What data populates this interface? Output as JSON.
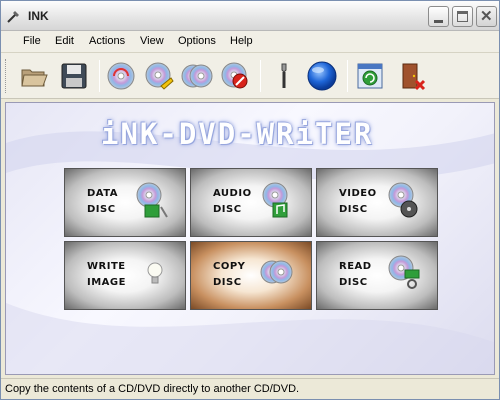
{
  "window": {
    "title": "INK"
  },
  "menu": {
    "items": [
      "File",
      "Edit",
      "Actions",
      "View",
      "Options",
      "Help"
    ]
  },
  "toolbar": {
    "icons": [
      "open-folder-icon",
      "save-disk-icon",
      "burn-disc-icon",
      "disc-edit-icon",
      "copy-disc-icon",
      "erase-disc-icon",
      "wrench-settings-icon",
      "blue-orb-icon",
      "refresh-window-icon",
      "exit-door-icon"
    ]
  },
  "banner": {
    "text": "iNK-DVD-WRiTER"
  },
  "tiles": [
    {
      "line1": "DATA",
      "line2": "DISC"
    },
    {
      "line1": "AUDIO",
      "line2": "DISC"
    },
    {
      "line1": "VIDEO",
      "line2": "DISC"
    },
    {
      "line1": "WRITE",
      "line2": "IMAGE"
    },
    {
      "line1": "COPY",
      "line2": "DISC"
    },
    {
      "line1": "READ",
      "line2": "DISC"
    }
  ],
  "status": {
    "text": "Copy the contents of a CD/DVD directly to another CD/DVD."
  },
  "colors": {
    "accent": "#2a6fd6",
    "active_tile": "#c89060"
  }
}
